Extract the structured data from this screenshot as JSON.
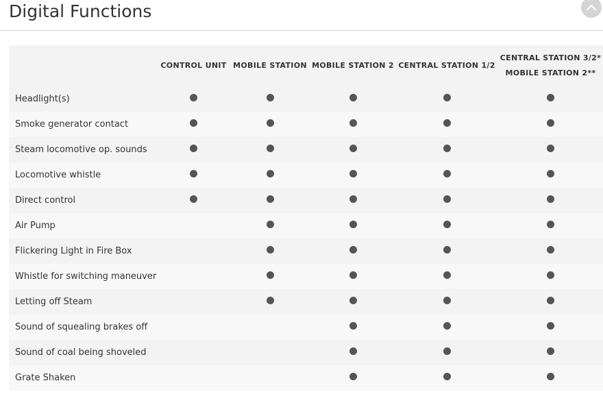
{
  "page": {
    "title": "Digital Functions",
    "collapse_icon": "chevron-up-icon"
  },
  "table": {
    "columns": [
      {
        "label_lines": [
          "CONTROL UNIT"
        ]
      },
      {
        "label_lines": [
          "MOBILE STATION"
        ]
      },
      {
        "label_lines": [
          "MOBILE STATION 2"
        ]
      },
      {
        "label_lines": [
          "CENTRAL STATION 1/2"
        ]
      },
      {
        "label_lines": [
          "CENTRAL STATION 3/2*",
          "MOBILE STATION 2**"
        ]
      }
    ],
    "rows": [
      {
        "name": "Headlight(s)",
        "support": [
          true,
          true,
          true,
          true,
          true
        ]
      },
      {
        "name": "Smoke generator contact",
        "support": [
          true,
          true,
          true,
          true,
          true
        ]
      },
      {
        "name": "Steam locomotive op. sounds",
        "support": [
          true,
          true,
          true,
          true,
          true
        ]
      },
      {
        "name": "Locomotive whistle",
        "support": [
          true,
          true,
          true,
          true,
          true
        ]
      },
      {
        "name": "Direct control",
        "support": [
          true,
          true,
          true,
          true,
          true
        ]
      },
      {
        "name": "Air Pump",
        "support": [
          false,
          true,
          true,
          true,
          true
        ]
      },
      {
        "name": "Flickering Light in Fire Box",
        "support": [
          false,
          true,
          true,
          true,
          true
        ]
      },
      {
        "name": "Whistle for switching maneuver",
        "support": [
          false,
          true,
          true,
          true,
          true
        ]
      },
      {
        "name": "Letting off Steam",
        "support": [
          false,
          true,
          true,
          true,
          true
        ]
      },
      {
        "name": "Sound of squealing brakes off",
        "support": [
          false,
          false,
          true,
          true,
          true
        ]
      },
      {
        "name": "Sound of coal being shoveled",
        "support": [
          false,
          false,
          true,
          true,
          true
        ]
      },
      {
        "name": "Grate Shaken",
        "support": [
          false,
          false,
          true,
          true,
          true
        ]
      }
    ]
  }
}
